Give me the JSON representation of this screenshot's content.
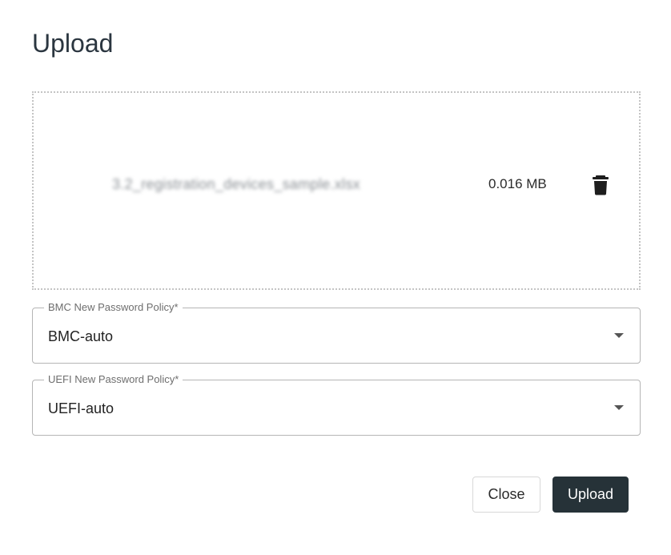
{
  "dialog": {
    "title": "Upload"
  },
  "file": {
    "name": "3.2_registration_devices_sample.xlsx",
    "size": "0.016 MB",
    "delete_icon": "trash-icon"
  },
  "bmc_policy": {
    "label": "BMC New Password Policy*",
    "value": "BMC-auto",
    "dropdown_icon": "caret-down-icon"
  },
  "uefi_policy": {
    "label": "UEFI New Password Policy*",
    "value": "UEFI-auto",
    "dropdown_icon": "caret-down-icon"
  },
  "actions": {
    "close_label": "Close",
    "upload_label": "Upload"
  },
  "colors": {
    "primary_button": "#263238",
    "title_text": "#2b3640"
  }
}
